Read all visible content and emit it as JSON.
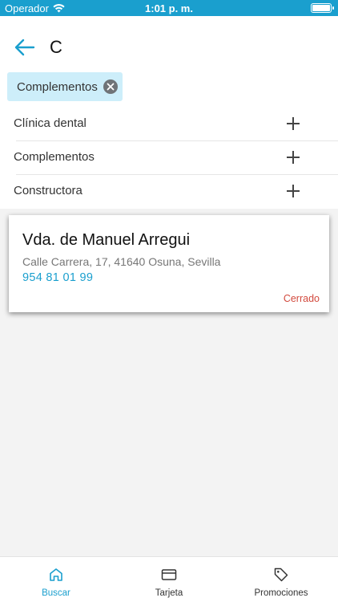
{
  "status_bar": {
    "carrier": "Operador",
    "time": "1:01 p. m."
  },
  "search": {
    "query": "C"
  },
  "filter_chip": {
    "label": "Complementos"
  },
  "suggestions": [
    {
      "label": "Clínica dental"
    },
    {
      "label": "Complementos"
    },
    {
      "label": "Constructora"
    }
  ],
  "result": {
    "name": "Vda. de Manuel Arregui",
    "address": "Calle Carrera, 17, 41640 Osuna, Sevilla",
    "phone": "954 81 01 99",
    "status": "Cerrado"
  },
  "tabs": [
    {
      "label": "Buscar",
      "icon": "home-icon",
      "active": true
    },
    {
      "label": "Tarjeta",
      "icon": "card-icon",
      "active": false
    },
    {
      "label": "Promociones",
      "icon": "tag-icon",
      "active": false
    }
  ],
  "colors": {
    "accent": "#1a9fce",
    "chip_bg": "#cdeefa",
    "closed": "#d24a3e"
  }
}
